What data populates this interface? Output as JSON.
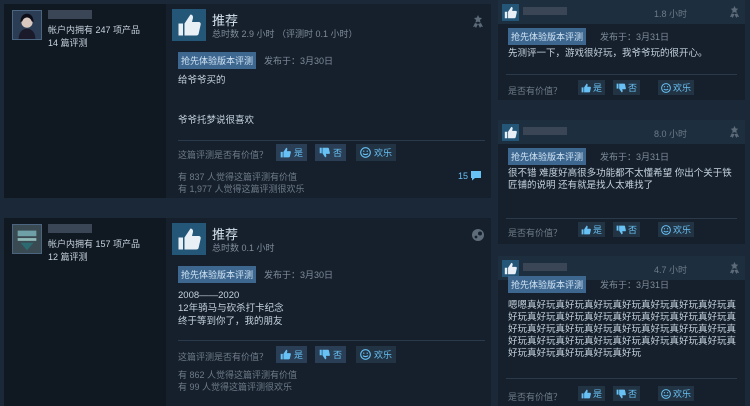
{
  "reviews": [
    {
      "user_stats_line1": "帐户内拥有 247 项产品",
      "user_stats_line2": "14 篇评测",
      "recommendation": "推荐",
      "hours": "总时数 2.9 小时 （评测时 0.1 小时）",
      "badge": "抢先体验版本评测",
      "posted": "发布于：3月30日",
      "body_line1": "给爷爷买的",
      "body_line2": "爷爷托梦说很喜欢",
      "helpful_question": "这篇评测是否有价值？",
      "yes_label": "是",
      "no_label": "否",
      "funny_label": "欢乐",
      "helpful_count": "有 837 人觉得这篇评测有价值",
      "funny_count": "有 1,977 人觉得这篇评测很欢乐",
      "comment_count": "15"
    },
    {
      "user_stats_line1": "帐户内拥有 157 项产品",
      "user_stats_line2": "12 篇评测",
      "recommendation": "推荐",
      "hours": "总时数 0.1 小时",
      "badge": "抢先体验版本评测",
      "posted": "发布于：3月30日",
      "body_line1": "2008——2020",
      "body_line2": "12年骑马与砍杀打卡纪念",
      "body_line3": "终于等到你了，我的朋友",
      "helpful_question": "这篇评测是否有价值？",
      "yes_label": "是",
      "no_label": "否",
      "funny_label": "欢乐",
      "helpful_count": "有 862 人觉得这篇评测有价值",
      "funny_count": "有 99 人觉得这篇评测很欢乐"
    }
  ],
  "cards": [
    {
      "hours": "1.8 小时",
      "badge": "抢先体验版本评测",
      "posted": "发布于：3月31日",
      "text": "先测评一下，游戏很好玩，我爷爷玩的很开心。",
      "question": "是否有价值？",
      "yes_label": "是",
      "no_label": "否",
      "funny_label": "欢乐"
    },
    {
      "hours": "8.0 小时",
      "badge": "抢先体验版本评测",
      "posted": "发布于：3月31日",
      "text": "很不错 难度好高很多功能都不太懂希望 你出个关于铁匠铺的说明 还有就是找人太难找了",
      "question": "是否有价值？",
      "yes_label": "是",
      "no_label": "否",
      "funny_label": "欢乐"
    },
    {
      "hours": "4.7 小时",
      "badge": "抢先体验版本评测",
      "posted": "发布于：3月31日",
      "text": "嗯嗯真好玩真好玩真好玩真好玩真好玩真好玩真好玩真好玩真好玩真好玩真好玩真好玩真好玩真好玩真好玩真好玩真好玩真好玩真好玩真好玩真好玩真好玩真好玩真好玩真好玩真好玩真好玩真好玩真好玩真好玩真好玩真好玩真好玩真好玩真好玩真好玩",
      "question": "是否有价值？",
      "yes_label": "是",
      "no_label": "否",
      "funny_label": "欢乐"
    }
  ],
  "colors": {
    "background": "#1b2838",
    "panel": "#16202d",
    "accent_blue": "#67c1f5",
    "badge_blue": "#3e6790"
  },
  "icons": {
    "recommend": "thumbs-up-icon",
    "yes": "thumbs-up-icon",
    "no": "thumbs-down-icon",
    "funny": "smiley-icon",
    "award": "award-icon",
    "steam": "steam-icon",
    "comments": "comment-icon"
  }
}
